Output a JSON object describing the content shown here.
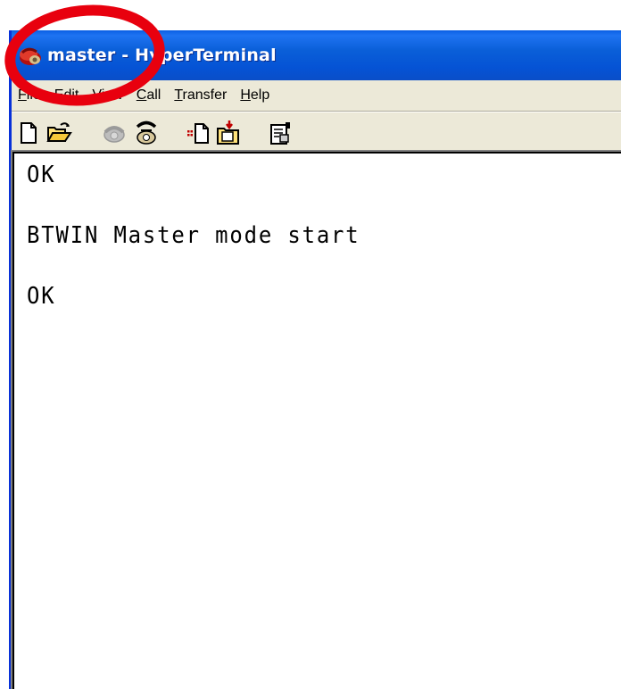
{
  "window": {
    "title": "master - HyperTerminal",
    "icon": "hyperterminal-phone-icon"
  },
  "menu": {
    "items": [
      {
        "label_pre": "",
        "accel": "F",
        "label_post": "ile"
      },
      {
        "label_pre": "",
        "accel": "E",
        "label_post": "dit"
      },
      {
        "label_pre": "",
        "accel": "V",
        "label_post": "iew"
      },
      {
        "label_pre": "",
        "accel": "C",
        "label_post": "all"
      },
      {
        "label_pre": "",
        "accel": "T",
        "label_post": "ransfer"
      },
      {
        "label_pre": "",
        "accel": "H",
        "label_post": "elp"
      }
    ]
  },
  "toolbar": {
    "buttons": [
      "new-icon",
      "open-icon",
      "connect-icon",
      "disconnect-icon",
      "send-icon",
      "receive-icon",
      "properties-icon"
    ]
  },
  "terminal": {
    "lines": [
      "OK",
      "BTWIN Master mode start",
      "OK"
    ]
  },
  "annotation": {
    "color": "#e8000e"
  }
}
